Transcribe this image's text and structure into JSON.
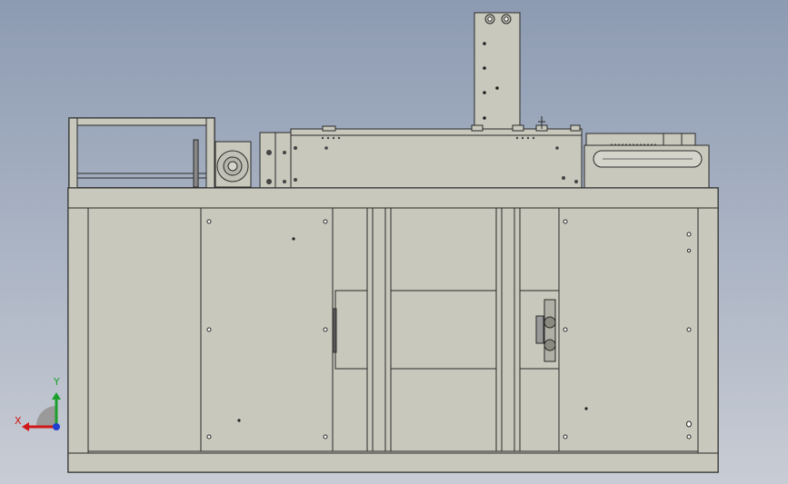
{
  "viewport": {
    "background_top": "#8d9bb2",
    "background_bottom": "#c8ccd4"
  },
  "model": {
    "name": "machine-assembly-front-view",
    "body_color": "#c8c8bc",
    "edge_color": "#2a2a2a"
  },
  "triad": {
    "x_label": "X",
    "y_label": "Y",
    "x_color": "#d01818",
    "y_color": "#1aa02a",
    "z_color": "#1f3fd0"
  }
}
